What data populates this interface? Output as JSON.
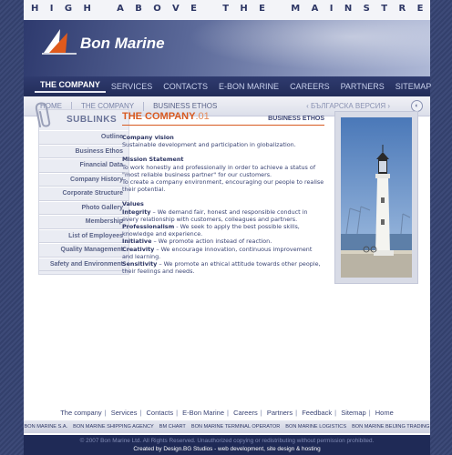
{
  "tagline": "HIGH ABOVE THE MAINSTREAM",
  "logo": {
    "text": "Bon Marine"
  },
  "main_nav": [
    {
      "label": "THE COMPANY",
      "active": true
    },
    {
      "label": "SERVICES"
    },
    {
      "label": "CONTACTS"
    },
    {
      "label": "E-BON MARINE"
    },
    {
      "label": "CAREERS"
    },
    {
      "label": "PARTNERS"
    },
    {
      "label": "SITEMAP"
    }
  ],
  "breadcrumb": {
    "items": [
      "HOME",
      "THE COMPANY",
      "BUSINESS ETHOS"
    ],
    "language_link": "‹ БЪЛГАРСКА ВЕРСИЯ ›"
  },
  "sidebar": {
    "title": "SUBLINKS",
    "items": [
      "Outline",
      "Business Ethos",
      "Financial Data",
      "Company History",
      "Corporate Structure",
      "Photo Gallery",
      "Membership",
      "List of Employees",
      "Quality Management",
      "Safety and Environment"
    ]
  },
  "content": {
    "heading": "THE COMPANY",
    "heading_number": ".01",
    "subheading": "BUSINESS ETHOS",
    "vision_title": "Company vision",
    "vision_text": "Sustainable development and participation in globalization.",
    "mission_title": "Mission Statement",
    "mission_text_1": "To work honestly and professionally in order to achieve a status of \"most reliable business partner\" for our customers.",
    "mission_text_2": "To create a company environment, encouraging our people to realise their potential.",
    "values_title": "Values",
    "values": [
      {
        "name": "Integrity",
        "text": " – We demand fair, honest and responsible conduct in every relationship with customers, colleagues and partners."
      },
      {
        "name": "Professionalism",
        "text": " - We seek to apply the best possible skills, knowledge and experience."
      },
      {
        "name": "Initiative",
        "text": " – We promote action instead of reaction."
      },
      {
        "name": "Creativity",
        "text": " – We encourage innovation, continuous improvement and learning."
      },
      {
        "name": "Sensitivity",
        "text": " – We promote an ethical attitude towards other people, their feelings and needs."
      }
    ]
  },
  "footer_nav": [
    "The company",
    "Services",
    "Contacts",
    "E-Bon Marine",
    "Careers",
    "Partners",
    "Feedback",
    "Sitemap",
    "Home"
  ],
  "partners": [
    "BON MARINE S.A.",
    "BON MARINE SHIPPING AGENCY",
    "BM CHART",
    "BON MARINE TERMINAL OPERATOR",
    "BON MARINE LOGISTICS",
    "BON MARINE BEIJING TRADING"
  ],
  "copyright": "© 2007 Bon Marine Ltd. All Rights Reserved. Unauthorized copying or redistributing without permission prohibited.",
  "credits": "Created by Design.BG Studios - web development, site design & hosting",
  "colors": {
    "accent": "#d85a20",
    "navy": "#2e3765",
    "nav_bg": "#222c58"
  }
}
